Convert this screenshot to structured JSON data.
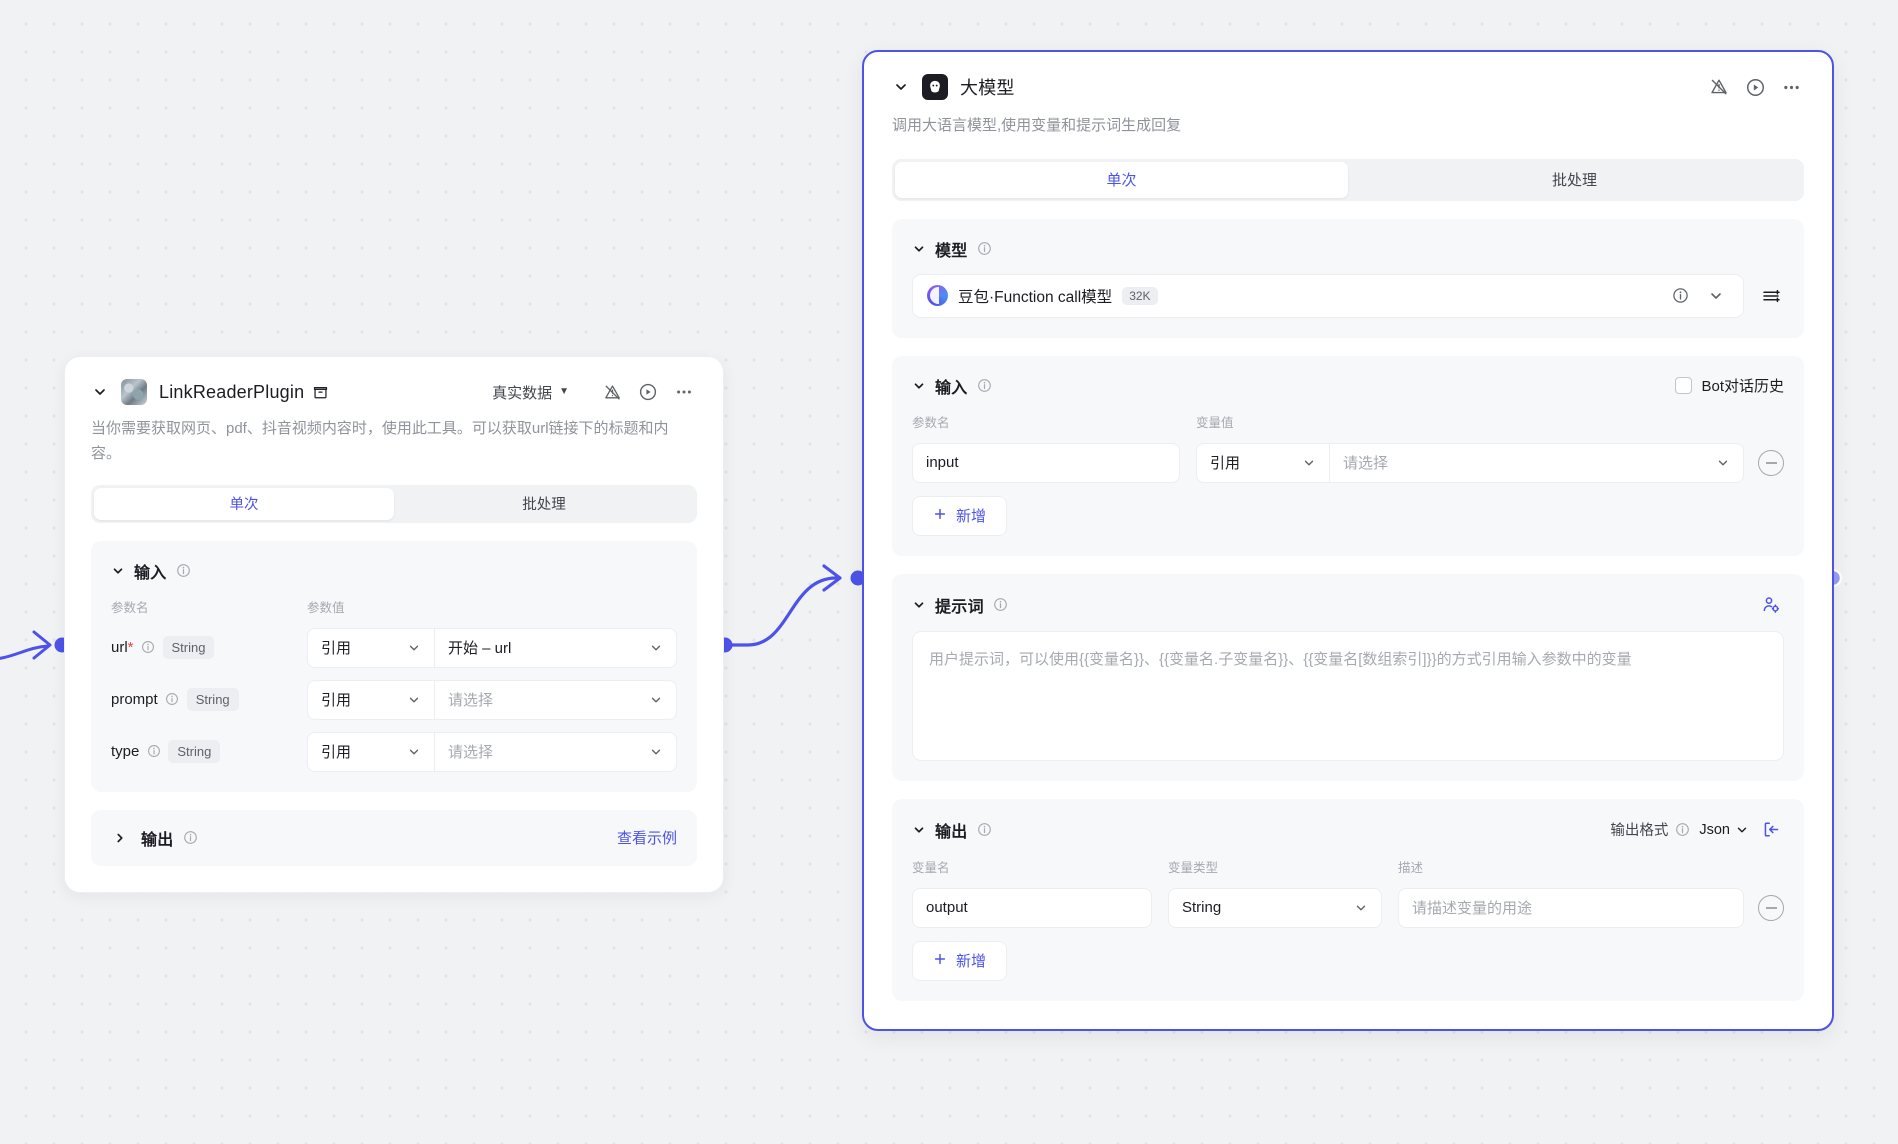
{
  "canvas": {
    "background_color": "#f1f2f4",
    "accent_color": "#4d53e8"
  },
  "plugin_node": {
    "title": "LinkReaderPlugin",
    "avatar_icon": "plugin-avatar-icon",
    "title_badge_icon": "store-icon",
    "data_mode": {
      "label": "真实数据",
      "caret_icon": "caret-down-icon"
    },
    "header_icons": [
      "mute-warning-icon",
      "run-icon",
      "more-icon"
    ],
    "description": "当你需要获取网页、pdf、抖音视频内容时，使用此工具。可以获取url链接下的标题和内容。",
    "tabs": [
      {
        "label": "单次",
        "active": true
      },
      {
        "label": "批处理",
        "active": false
      }
    ],
    "input_section": {
      "title": "输入",
      "info_icon": "info-icon",
      "collapse_icon": "chevron-down-icon",
      "columns": [
        "参数名",
        "参数值"
      ],
      "rows": [
        {
          "name": "url",
          "required": true,
          "type": "String",
          "ref_mode": "引用",
          "value": "开始 – url",
          "value_is_placeholder": false
        },
        {
          "name": "prompt",
          "required": false,
          "type": "String",
          "ref_mode": "引用",
          "value": "请选择",
          "value_is_placeholder": true
        },
        {
          "name": "type",
          "required": false,
          "type": "String",
          "ref_mode": "引用",
          "value": "请选择",
          "value_is_placeholder": true
        }
      ]
    },
    "output_section": {
      "title": "输出",
      "info_icon": "info-icon",
      "collapse_icon": "chevron-right-icon",
      "example_link": "查看示例"
    }
  },
  "llm_node": {
    "title": "大模型",
    "avatar_icon": "llm-avatar-icon",
    "header_icons": [
      "mute-warning-icon",
      "run-icon",
      "more-icon"
    ],
    "description": "调用大语言模型,使用变量和提示词生成回复",
    "tabs": [
      {
        "label": "单次",
        "active": true
      },
      {
        "label": "批处理",
        "active": false
      }
    ],
    "model_section": {
      "title": "模型",
      "info_icon": "info-icon",
      "collapse_icon": "chevron-down-icon",
      "model_name": "豆包·Function call模型",
      "context_badge": "32K",
      "model_info_icon": "info-icon",
      "model_caret_icon": "chevron-down-icon",
      "settings_icon": "sliders-icon"
    },
    "input_section": {
      "title": "输入",
      "info_icon": "info-icon",
      "collapse_icon": "chevron-down-icon",
      "bot_history": {
        "label": "Bot对话历史",
        "checked": false
      },
      "columns": [
        "参数名",
        "变量值"
      ],
      "rows": [
        {
          "name": "input",
          "ref_mode": "引用",
          "value": "请选择",
          "value_is_placeholder": true,
          "remove_icon": "minus-circle-icon"
        }
      ],
      "add_button": {
        "label": "新增",
        "icon": "plus-icon"
      }
    },
    "prompt_section": {
      "title": "提示词",
      "info_icon": "info-icon",
      "collapse_icon": "chevron-down-icon",
      "persona_icon": "user-settings-icon",
      "placeholder": "用户提示词，可以使用{{变量名}}、{{变量名.子变量名}}、{{变量名[数组索引]}}的方式引用输入参数中的变量",
      "value": ""
    },
    "output_section": {
      "title": "输出",
      "info_icon": "info-icon",
      "collapse_icon": "chevron-down-icon",
      "format_label": "输出格式",
      "format_info_icon": "info-icon",
      "format_value": "Json",
      "format_caret_icon": "chevron-down-icon",
      "import_icon": "import-icon",
      "columns": [
        "变量名",
        "变量类型",
        "描述"
      ],
      "rows": [
        {
          "name": "output",
          "type": "String",
          "description": "请描述变量的用途",
          "description_is_placeholder": true,
          "remove_icon": "minus-circle-icon"
        }
      ],
      "add_button": {
        "label": "新增",
        "icon": "plus-icon"
      }
    }
  },
  "connections": [
    {
      "from": "offscreen-left",
      "to": "plugin-node-input-port",
      "color": "#4d53e8"
    },
    {
      "from": "plugin-node-output-port",
      "to": "llm-node-input-port",
      "color": "#4d53e8"
    }
  ]
}
